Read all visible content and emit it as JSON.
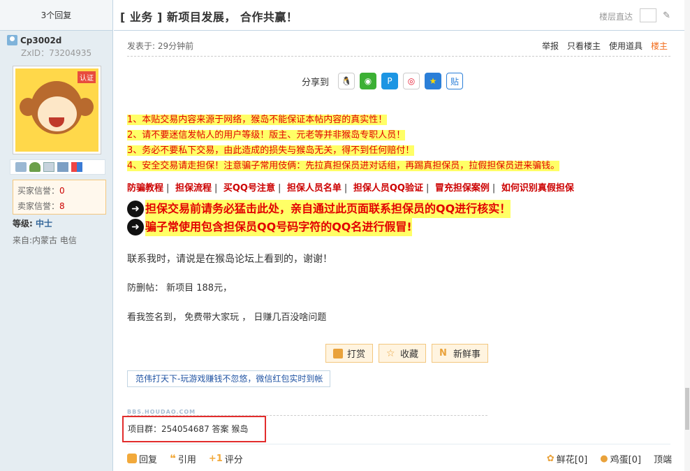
{
  "sidebar": {
    "reply_count": "3个回复",
    "username": "Cp3002d",
    "zxid": "ZxID：73204935",
    "avatar_tag": "认证",
    "buyer_credit_label": "买家信誉：",
    "buyer_credit_value": "0",
    "seller_credit_label": "卖家信誉：",
    "seller_credit_value": "8",
    "level_label": "等级: ",
    "level_value": "中士",
    "from": "来自:内蒙古 电信"
  },
  "header": {
    "title": "[ 业务 ] 新项目发展， 合作共赢！",
    "floor_go": "楼层直达"
  },
  "post": {
    "time": "发表于: 29分钟前",
    "actions": [
      "举报",
      "只看楼主",
      "使用道具",
      "楼主"
    ],
    "share_label": "分享到",
    "notices": [
      "1、本贴交易内容来源于网络，猴岛不能保证本帖内容的真实性！",
      "2、请不要迷信发帖人的用户等级！版主、元老等并非猴岛专职人员！",
      "3、务必不要私下交易，由此造成的损失与猴岛无关，得不到任何赔付！",
      "4、安全交易请走担保！注意骗子常用伎俩：先拉真担保员进对话组，再踢真担保员，拉假担保员进来骗钱。"
    ],
    "links": [
      "防骗教程",
      "担保流程",
      "买QQ号注意",
      "担保人员名单",
      "担保人员QQ验证",
      "冒充担保案例",
      "如何识别真假担保"
    ],
    "warn1": "担保交易前请务必猛击此处，亲自通过此页面联系担保员的QQ进行核实！",
    "warn2": "骗子常使用包含担保员QQ号码字符的QQ名进行假冒!",
    "contact": "联系我时，请说是在猴岛论坛上看到的，谢谢！",
    "anti_delete": "防删帖： 新项目 188元，",
    "signin": "看我签名到， 免费带大家玩 ， 日赚几百没啥问题",
    "btn_reward": "打赏",
    "btn_fav": "收藏",
    "btn_news": "新鲜事",
    "sig_link": "范伟打天下-玩游戏赚钱不忽悠，微信红包实时到帐",
    "watermark": "BBS.HOUDAO.COM",
    "signature": "项目群：254054687 答案 猴岛"
  },
  "footer": {
    "reply": "回复",
    "quote": "引用",
    "rate": "评分",
    "flower": "鲜花[0]",
    "egg": "鸡蛋[0]",
    "top": "顶端"
  }
}
